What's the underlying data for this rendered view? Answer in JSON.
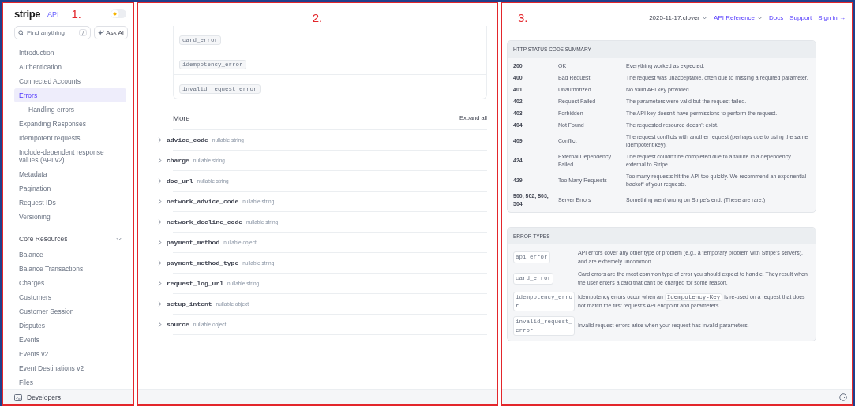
{
  "annotations": [
    "1.",
    "2.",
    "3."
  ],
  "sidebar": {
    "logo": "stripe",
    "logo_suffix": "API",
    "theme_toggle": {
      "on": false
    },
    "search": {
      "placeholder": "Find anything",
      "shortcut": "/"
    },
    "ask_ai": "Ask AI",
    "items": [
      {
        "label": "Introduction",
        "selected": false
      },
      {
        "label": "Authentication",
        "selected": false
      },
      {
        "label": "Connected Accounts",
        "selected": false
      },
      {
        "label": "Errors",
        "selected": true,
        "children": [
          {
            "label": "Handling errors",
            "selected": false
          }
        ]
      },
      {
        "label": "Expanding Responses",
        "selected": false
      },
      {
        "label": "Idempotent requests",
        "selected": false
      },
      {
        "label": "Include-dependent response values (API v2)",
        "selected": false
      },
      {
        "label": "Metadata",
        "selected": false
      },
      {
        "label": "Pagination",
        "selected": false
      },
      {
        "label": "Request IDs",
        "selected": false
      },
      {
        "label": "Versioning",
        "selected": false
      }
    ],
    "section": {
      "title": "Core Resources",
      "expanded": true,
      "items": [
        {
          "label": "Balance",
          "selected": false
        },
        {
          "label": "Balance Transactions",
          "selected": false
        },
        {
          "label": "Charges",
          "selected": false
        },
        {
          "label": "Customers",
          "selected": false
        },
        {
          "label": "Customer Session",
          "selected": false
        },
        {
          "label": "Disputes",
          "selected": false
        },
        {
          "label": "Events",
          "selected": false
        },
        {
          "label": "Events v2",
          "selected": false
        },
        {
          "label": "Event Destinations v2",
          "selected": false
        },
        {
          "label": "Files",
          "selected": false
        }
      ]
    },
    "footer": "Developers"
  },
  "middle": {
    "codes": [
      "card_error",
      "idempotency_error",
      "invalid_request_error"
    ],
    "more": {
      "title": "More",
      "action": "Expand all",
      "attributes": [
        {
          "name": "advice_code",
          "type": "nullable string"
        },
        {
          "name": "charge",
          "type": "nullable string"
        },
        {
          "name": "doc_url",
          "type": "nullable string"
        },
        {
          "name": "network_advice_code",
          "type": "nullable string"
        },
        {
          "name": "network_decline_code",
          "type": "nullable string"
        },
        {
          "name": "payment_method",
          "type": "nullable object"
        },
        {
          "name": "payment_method_type",
          "type": "nullable string"
        },
        {
          "name": "request_log_url",
          "type": "nullable string"
        },
        {
          "name": "setup_intent",
          "type": "nullable object"
        },
        {
          "name": "source",
          "type": "nullable object"
        }
      ]
    }
  },
  "topbar": {
    "version": "2025-11-17.clover",
    "links": [
      {
        "label": "API Reference",
        "dropdown": true
      },
      {
        "label": "Docs",
        "dropdown": false
      },
      {
        "label": "Support",
        "dropdown": false
      },
      {
        "label": "Sign in →",
        "dropdown": false
      }
    ]
  },
  "status_summary": {
    "title": "HTTP STATUS CODE SUMMARY",
    "rows": [
      {
        "code": "200",
        "name": "OK",
        "description": "Everything worked as expected."
      },
      {
        "code": "400",
        "name": "Bad Request",
        "description": "The request was unacceptable, often due to missing a required parameter."
      },
      {
        "code": "401",
        "name": "Unauthorized",
        "description": "No valid API key provided."
      },
      {
        "code": "402",
        "name": "Request Failed",
        "description": "The parameters were valid but the request failed."
      },
      {
        "code": "403",
        "name": "Forbidden",
        "description": "The API key doesn't have permissions to perform the request."
      },
      {
        "code": "404",
        "name": "Not Found",
        "description": "The requested resource doesn't exist."
      },
      {
        "code": "409",
        "name": "Conflict",
        "description": "The request conflicts with another request (perhaps due to using the same idempotent key)."
      },
      {
        "code": "424",
        "name": "External Dependency Failed",
        "description": "The request couldn't be completed due to a failure in a dependency external to Stripe."
      },
      {
        "code": "429",
        "name": "Too Many Requests",
        "description": "Too many requests hit the API too quickly. We recommend an exponential backoff of your requests."
      },
      {
        "code": "500, 502, 503, 504",
        "name": "Server Errors",
        "description": "Something went wrong on Stripe's end. (These are rare.)"
      }
    ]
  },
  "error_types": {
    "title": "ERROR TYPES",
    "rows": [
      {
        "code": "api_error",
        "description": [
          {
            "kind": "text",
            "text": "API errors cover any other type of problem (e.g., a temporary problem with Stripe's servers), and are extremely uncommon."
          }
        ]
      },
      {
        "code": "card_error",
        "description": [
          {
            "kind": "text",
            "text": "Card errors are the most common type of error you should expect to handle. They result when the user enters a card that can't be charged for some reason."
          }
        ]
      },
      {
        "code": "idempotency_error",
        "description": [
          {
            "kind": "text",
            "text": "Idempotency errors occur when an"
          },
          {
            "kind": "code",
            "text": "Idempotency-Key"
          },
          {
            "kind": "text",
            "text": "is re-used on a request that does not match the first request's API endpoint and parameters."
          }
        ]
      },
      {
        "code": "invalid_request_error",
        "description": [
          {
            "kind": "text",
            "text": "Invalid request errors arise when your request has invalid parameters."
          }
        ]
      }
    ]
  }
}
